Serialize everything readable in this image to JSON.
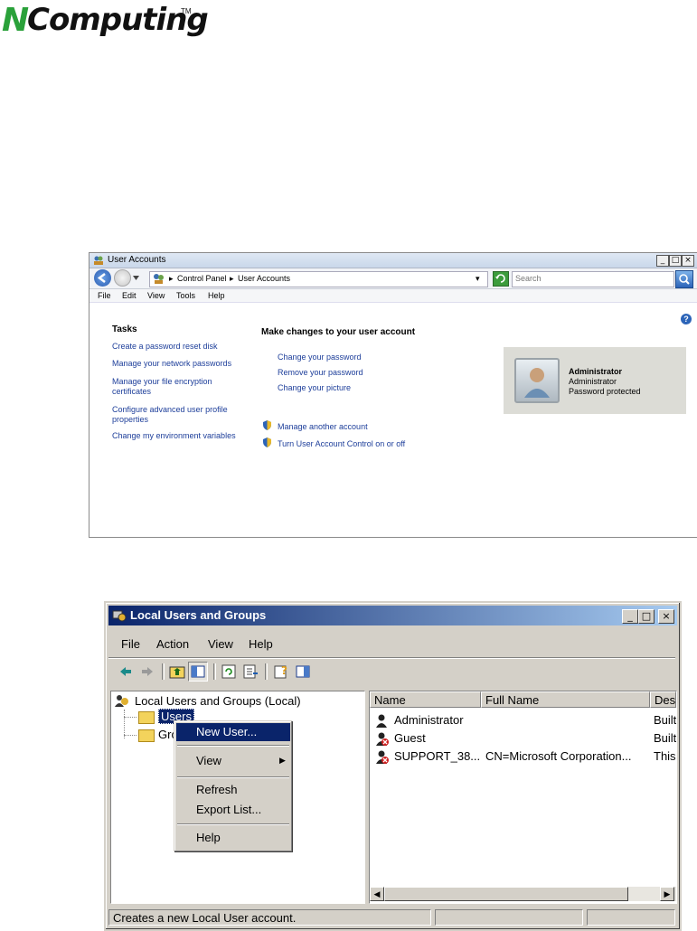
{
  "logo": {
    "text": "NComputing",
    "tm": "TM"
  },
  "user_accounts": {
    "title": "User Accounts",
    "breadcrumb": [
      "Control Panel",
      "User Accounts"
    ],
    "search_placeholder": "Search",
    "menu": [
      "File",
      "Edit",
      "View",
      "Tools",
      "Help"
    ],
    "tasks_heading": "Tasks",
    "tasks": [
      "Create a password reset disk",
      "Manage your network passwords",
      "Manage your file encryption",
      "certificates",
      "Configure advanced user profile",
      "properties",
      "Change my environment variables"
    ],
    "main_heading": "Make changes to your user account",
    "actions": [
      "Change your password",
      "Remove your password",
      "Change your picture"
    ],
    "shield_actions": [
      "Manage another account",
      "Turn User Account Control on or off"
    ],
    "account": {
      "name": "Administrator",
      "type": "Administrator",
      "status": "Password protected"
    }
  },
  "lusrmgr": {
    "title": "Local Users and Groups",
    "menu": [
      "File",
      "Action",
      "View",
      "Help"
    ],
    "tree_root": "Local Users and Groups (Local)",
    "tree_users": "Users",
    "tree_groups": "Gro",
    "columns": [
      "Name",
      "Full Name",
      "Des"
    ],
    "rows": [
      {
        "name": "Administrator",
        "full_name": "",
        "desc": "Built"
      },
      {
        "name": "Guest",
        "full_name": "",
        "desc": "Built"
      },
      {
        "name": "SUPPORT_38...",
        "full_name": "CN=Microsoft Corporation...",
        "desc": "This"
      }
    ],
    "context_menu": [
      "New User...",
      "View",
      "Refresh",
      "Export List...",
      "Help"
    ],
    "status_text": "Creates a new Local User account."
  }
}
